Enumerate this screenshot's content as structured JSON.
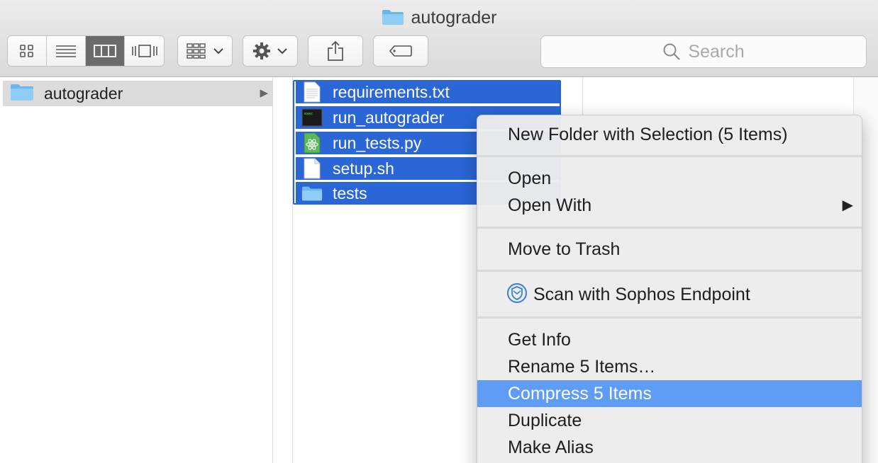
{
  "window": {
    "title": "autograder"
  },
  "toolbar": {
    "view_modes": [
      "icon-view",
      "list-view",
      "column-view",
      "cover-flow-view"
    ],
    "active_view": "column-view",
    "search_placeholder": "Search"
  },
  "sidebar_column": {
    "items": [
      {
        "label": "autograder",
        "selected": true,
        "has_children": true
      }
    ]
  },
  "files": [
    {
      "name": "requirements.txt",
      "icon": "text-file-icon",
      "selected": true
    },
    {
      "name": "run_autograder",
      "icon": "terminal-exec-icon",
      "selected": true
    },
    {
      "name": "run_tests.py",
      "icon": "python-atom-icon",
      "selected": true
    },
    {
      "name": "setup.sh",
      "icon": "script-file-icon",
      "selected": true
    },
    {
      "name": "tests",
      "icon": "folder-icon",
      "selected": true
    }
  ],
  "context_menu": {
    "groups": [
      [
        {
          "label": "New Folder with Selection (5 Items)"
        }
      ],
      [
        {
          "label": "Open"
        },
        {
          "label": "Open With",
          "submenu": true
        }
      ],
      [
        {
          "label": "Move to Trash"
        }
      ],
      [
        {
          "label": "Scan with Sophos Endpoint",
          "icon": "sophos-shield-icon"
        }
      ],
      [
        {
          "label": "Get Info"
        },
        {
          "label": "Rename 5 Items…"
        },
        {
          "label": "Compress 5 Items",
          "highlighted": true
        },
        {
          "label": "Duplicate"
        },
        {
          "label": "Make Alias"
        }
      ]
    ],
    "submenu_arrow": "▶"
  },
  "colors": {
    "selection": "#2a66d6",
    "menu_highlight": "#5f9df4",
    "folder": "#6cb6ee"
  }
}
